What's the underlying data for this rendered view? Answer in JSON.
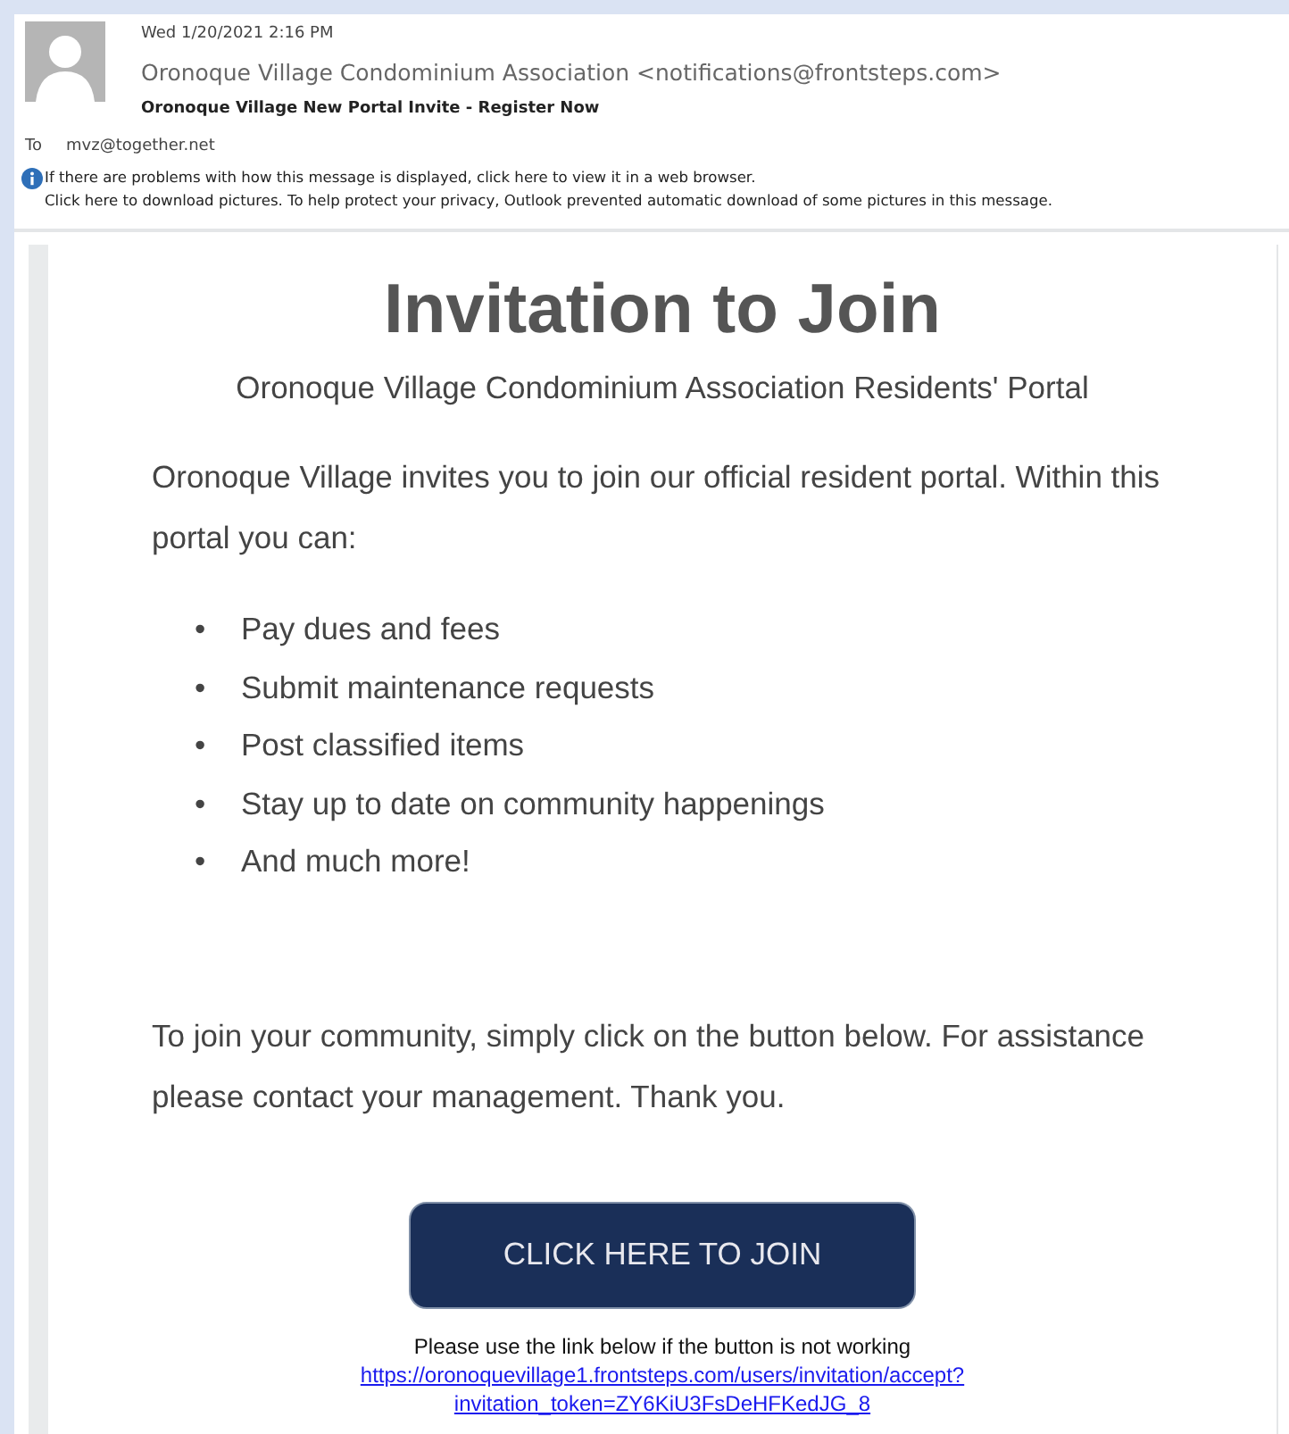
{
  "header": {
    "date": "Wed 1/20/2021 2:16 PM",
    "sender": "Oronoque Village Condominium Association <notifications@frontsteps.com>",
    "subject": "Oronoque Village New Portal Invite - Register Now",
    "to_label": "To",
    "to": "mvz@together.net",
    "info_lines": [
      "If there are problems with how this message is displayed, click here to view it in a web browser.",
      "Click here to download pictures. To help protect your privacy, Outlook prevented automatic download of some pictures in this message."
    ]
  },
  "body": {
    "title": "Invitation to Join",
    "subtitle": "Oronoque Village Condominium Association Residents' Portal",
    "intro": "Oronoque Village invites you to join our official resident portal. Within this portal you can:",
    "bullets": [
      {
        "marker": "•",
        "text": "Pay dues and fees"
      },
      {
        "marker": "•",
        "text": "Submit maintenance requests"
      },
      {
        "marker": "•",
        "text": "Post classified items"
      },
      {
        "marker": "•",
        "text": "Stay up to date on community happenings"
      },
      {
        "marker": "•",
        "text": "And much more!"
      }
    ],
    "outro": "To join your community, simply click on the button below. For assistance please contact your management. Thank you.",
    "button": "CLICK HERE TO JOIN",
    "fallback_note": "Please use the link below if the button is not working",
    "link_lines": [
      "https://oronoquevillage1.frontsteps.com/users/invitation/accept?",
      "invitation_token=ZY6KiU3FsDeHFKedJG_8"
    ]
  }
}
